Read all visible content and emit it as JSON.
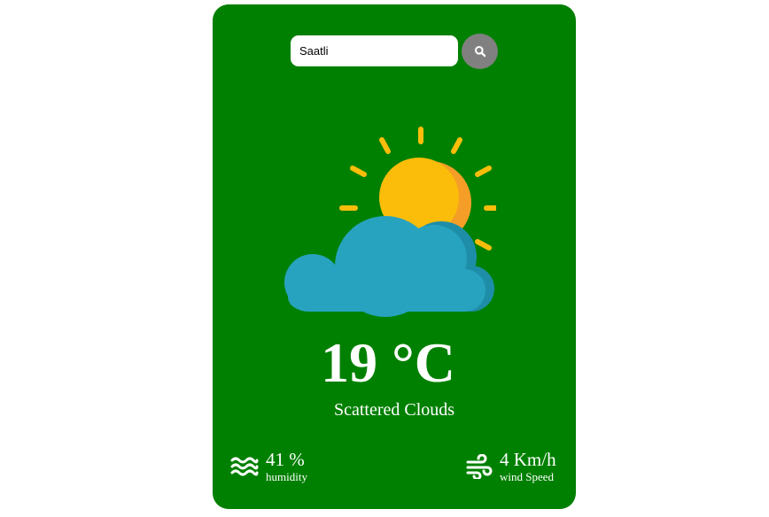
{
  "search": {
    "value": "Saatli"
  },
  "weather": {
    "icon": "sun-behind-cloud-icon",
    "temperature": "19 °C",
    "description": "Scattered Clouds"
  },
  "humidity": {
    "icon": "humidity-waves-icon",
    "value": "41 %",
    "label": "humidity"
  },
  "wind": {
    "icon": "wind-icon",
    "value": "4 Km/h",
    "label": "wind Speed"
  },
  "colors": {
    "card": "#008000",
    "search_button": "#808080",
    "sun": "#FBBD0A",
    "sun_shade": "#F59E27",
    "cloud": "#27A3BF",
    "cloud_shade": "#1E8EA8"
  }
}
